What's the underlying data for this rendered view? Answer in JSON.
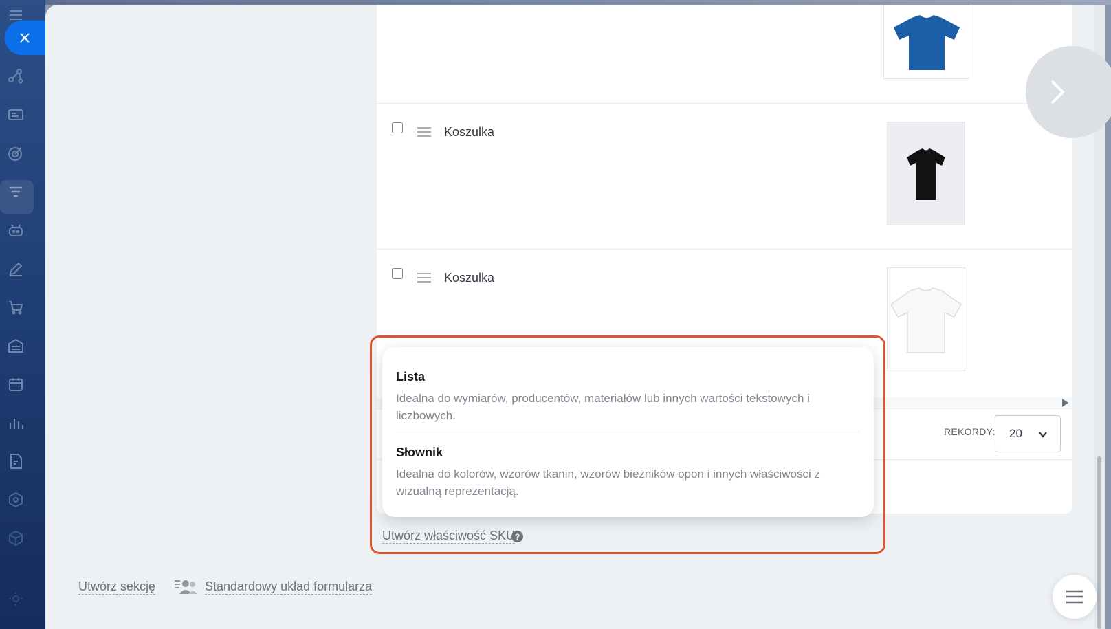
{
  "products": [
    {
      "name": "",
      "image_icon": "blue-tshirt",
      "color": "#1d5ea8"
    },
    {
      "name": "Koszulka",
      "image_icon": "black-tshirt",
      "color": "#111214"
    },
    {
      "name": "Koszulka",
      "image_icon": "white-tshirt",
      "color": "#f6f6f6"
    }
  ],
  "pagination": {
    "records_label": "REKORDY:",
    "records_value": "20"
  },
  "dropdown": {
    "items": [
      {
        "title": "Lista",
        "description": "Idealna do wymiarów, producentów, materiałów lub innych wartości tekstowych i liczbowych."
      },
      {
        "title": "Słownik",
        "description": "Idealna do kolorów, wzorów tkanin, wzorów bieżników opon i innych właściwości z wizualną reprezentacją."
      }
    ]
  },
  "actions": {
    "create_sku": "Utwórz właściwość SKU",
    "help": "?",
    "create_section": "Utwórz sekcję",
    "standard_layout": "Standardowy układ formularza"
  },
  "colors": {
    "accent": "#0a6fe8",
    "highlight": "#e0542e",
    "sidebar": "#1f3e73"
  }
}
